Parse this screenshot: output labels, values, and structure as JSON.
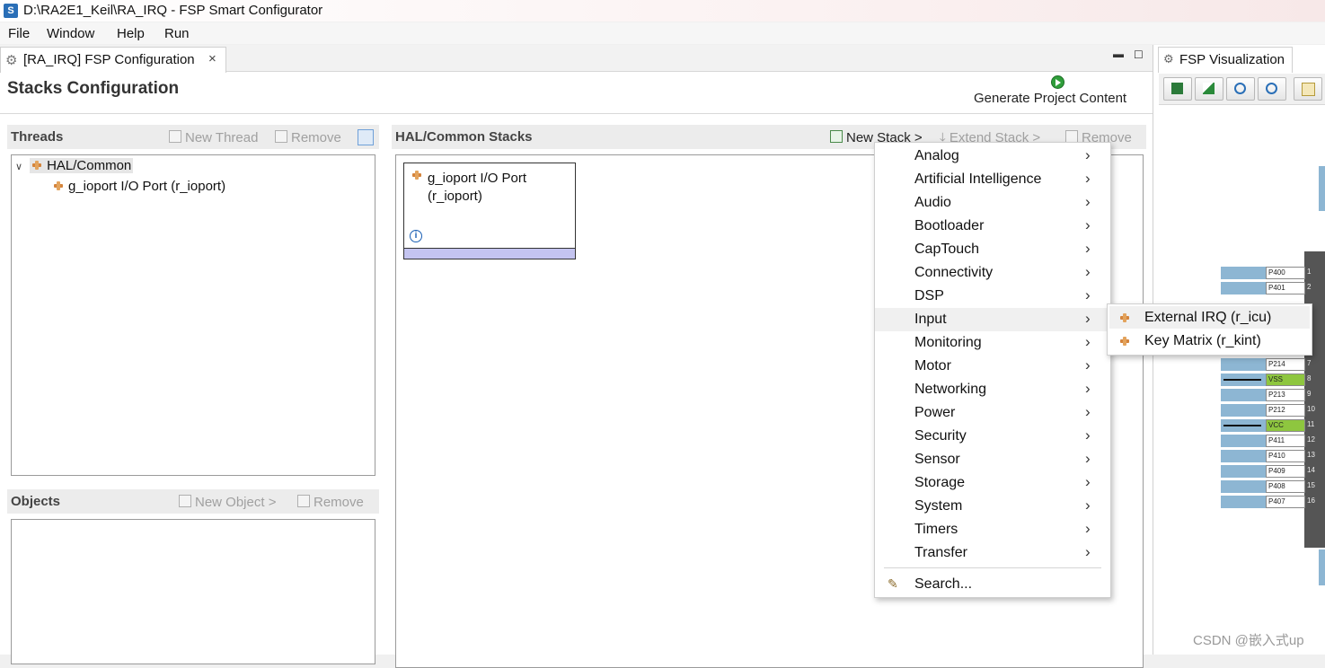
{
  "window": {
    "title": "D:\\RA2E1_Keil\\RA_IRQ - FSP Smart Configurator"
  },
  "menubar": [
    "File",
    "Window",
    "Help",
    "Run"
  ],
  "editor": {
    "tab_label": "[RA_IRQ] FSP Configuration",
    "tab_close": "×",
    "page_title": "Stacks Configuration",
    "generate_label": "Generate Project Content"
  },
  "threads": {
    "header": "Threads",
    "new_thread": "New Thread",
    "remove": "Remove",
    "tree": {
      "root": "HAL/Common",
      "child": "g_ioport I/O Port (r_ioport)"
    }
  },
  "objects": {
    "header": "Objects",
    "new_object": "New Object >",
    "remove": "Remove"
  },
  "stacks": {
    "header": "HAL/Common Stacks",
    "new_stack": "New Stack >",
    "extend_stack": "Extend Stack >",
    "remove": "Remove",
    "block_line1": "g_ioport I/O Port",
    "block_line2": "(r_ioport)"
  },
  "context_menu": {
    "items": [
      "Analog",
      "Artificial Intelligence",
      "Audio",
      "Bootloader",
      "CapTouch",
      "Connectivity",
      "DSP",
      "Input",
      "Monitoring",
      "Motor",
      "Networking",
      "Power",
      "Security",
      "Sensor",
      "Storage",
      "System",
      "Timers",
      "Transfer"
    ],
    "highlighted": "Input",
    "search": "Search..."
  },
  "submenu": {
    "items": [
      "External IRQ (r_icu)",
      "Key Matrix (r_kint)"
    ]
  },
  "visualization": {
    "tab_label": "FSP Visualization",
    "pins": [
      {
        "name": "P400",
        "num": "1"
      },
      {
        "name": "P401",
        "num": "2"
      },
      {
        "name": "P214",
        "num": "7"
      },
      {
        "name": "VSS",
        "num": "8",
        "power": true
      },
      {
        "name": "P213",
        "num": "9"
      },
      {
        "name": "P212",
        "num": "10"
      },
      {
        "name": "VCC",
        "num": "11",
        "power": true
      },
      {
        "name": "P411",
        "num": "12"
      },
      {
        "name": "P410",
        "num": "13"
      },
      {
        "name": "P409",
        "num": "14"
      },
      {
        "name": "P408",
        "num": "15"
      },
      {
        "name": "P407",
        "num": "16"
      }
    ]
  },
  "watermark": "CSDN @嵌入式up",
  "colors": {
    "stack_bar": "#c4c4f0",
    "pin_blue": "#8db6d3",
    "pin_power": "#8ec63f",
    "generate_icon": "#2f9e3a"
  }
}
